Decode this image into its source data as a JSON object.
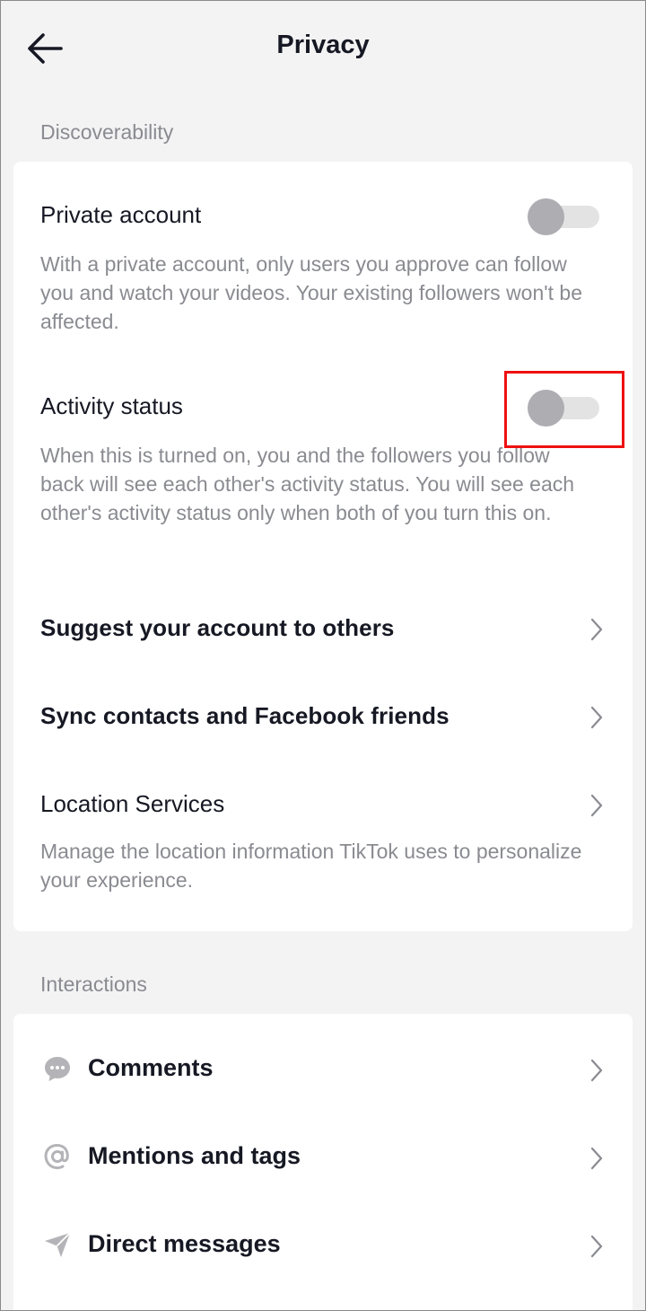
{
  "header": {
    "title": "Privacy",
    "back_icon": "arrow-left-icon"
  },
  "discoverability": {
    "label": "Discoverability",
    "private_account": {
      "title": "Private account",
      "desc": "With a private account, only users you approve can follow you and watch your videos. Your existing followers won't be affected.",
      "enabled": false
    },
    "activity_status": {
      "title": "Activity status",
      "desc": "When this is turned on, you and the followers you follow back will see each other's activity status. You will see each other's activity status only when both of you turn this on.",
      "enabled": false
    },
    "suggest": {
      "title": "Suggest your account to others"
    },
    "sync": {
      "title": "Sync contacts and Facebook friends"
    },
    "location": {
      "title": "Location Services",
      "desc": "Manage the location information TikTok uses to personalize your experience."
    }
  },
  "interactions": {
    "label": "Interactions",
    "items": [
      {
        "title": "Comments",
        "icon": "comment-bubble-icon"
      },
      {
        "title": "Mentions and tags",
        "icon": "at-sign-icon"
      },
      {
        "title": "Direct messages",
        "icon": "paper-plane-icon"
      }
    ]
  },
  "colors": {
    "background": "#f3f3f4",
    "card": "#ffffff",
    "text": "#161823",
    "muted": "#8a8b91",
    "toggle_knob": "#adadb2",
    "toggle_track": "#e3e3e4",
    "highlight": "#ee1111"
  }
}
